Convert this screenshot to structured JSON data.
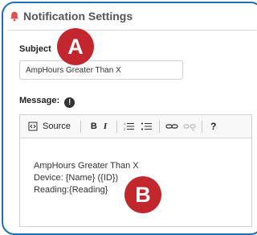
{
  "panel": {
    "title": "Notification Settings"
  },
  "subject": {
    "label": "Subject",
    "value": "AmpHours Greater Than X"
  },
  "message": {
    "label": "Message:",
    "info_glyph": "!",
    "toolbar": {
      "source_label": "Source",
      "bold_label": "B",
      "italic_label": "I",
      "help_label": "?"
    },
    "body_lines": [
      "AmpHours Greater Than X",
      "Device: {Name} ({ID})",
      "Reading:{Reading}"
    ]
  },
  "callouts": {
    "a": "A",
    "b": "B"
  },
  "colors": {
    "accent_frame": "#1f6fb2",
    "bell": "#d9534f",
    "callout": "#c2272d"
  }
}
